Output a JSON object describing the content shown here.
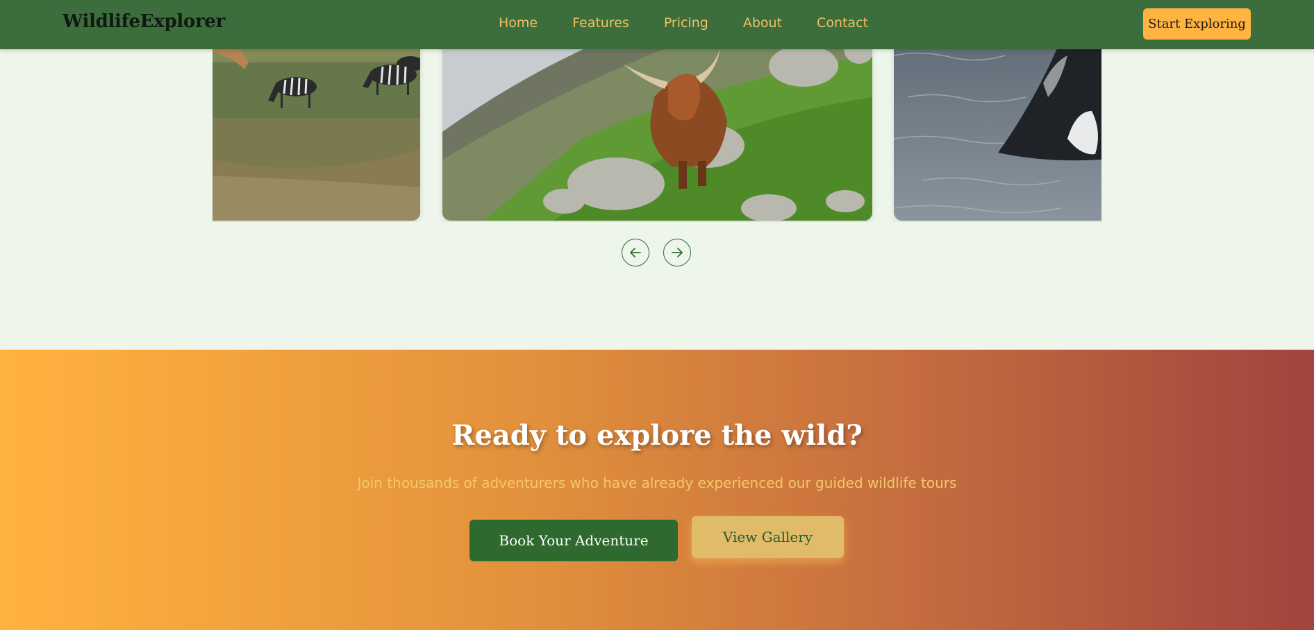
{
  "navbar": {
    "brand": "WildlifeExplorer",
    "links": [
      "Home",
      "Features",
      "Pricing",
      "About",
      "Contact"
    ],
    "cta_label": "Start Exploring"
  },
  "carousel": {
    "slides": [
      {
        "subject": "zebras-grassland"
      },
      {
        "subject": "highland-cow-hillside"
      },
      {
        "subject": "humpback-whale-breach"
      }
    ],
    "prev_icon": "arrow-left-icon",
    "next_icon": "arrow-right-icon"
  },
  "cta": {
    "title": "Ready to explore the wild?",
    "subtitle": "Join thousands of adventurers who have already experienced our guided wildlife tours",
    "primary_label": "Book Your Adventure",
    "secondary_label": "View Gallery"
  },
  "colors": {
    "nav_bg": "#3c6e3d",
    "accent": "#ffb340",
    "primary_button": "#2e6a30",
    "secondary_button": "#e0bc6a",
    "page_bg": "#eef5ea"
  }
}
